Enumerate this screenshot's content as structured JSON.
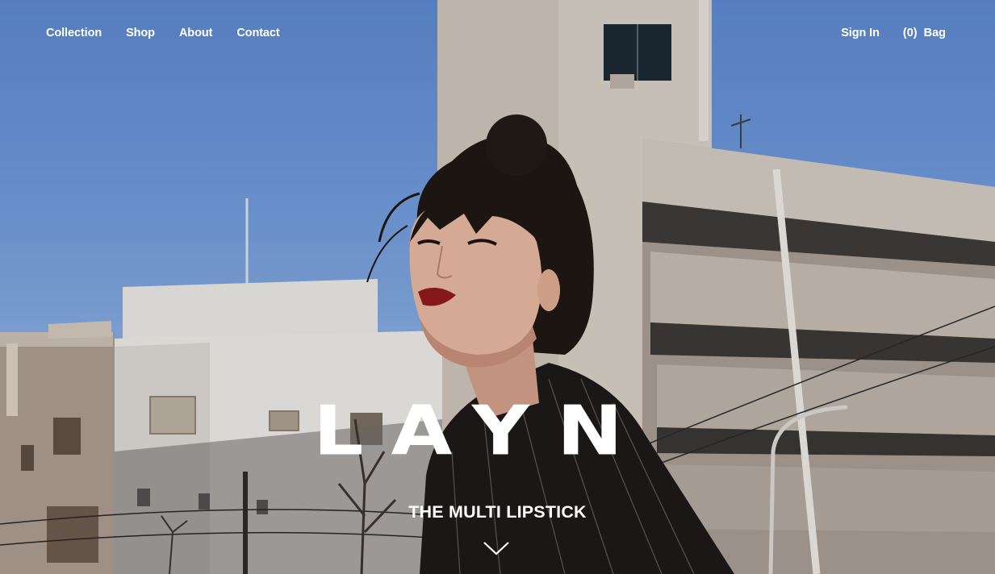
{
  "nav": {
    "left": [
      "Collection",
      "Shop",
      "About",
      "Contact"
    ],
    "sign_in": "Sign In",
    "bag_count": "(0)",
    "bag_label": "Bag"
  },
  "hero": {
    "brand": "LAYN",
    "tagline": "THE MULTI LIPSTICK",
    "scroll_icon": "chevron-down-icon"
  },
  "colors": {
    "sky": "#6e97d6",
    "text": "#ffffff",
    "lip": "#8e1b1b"
  }
}
